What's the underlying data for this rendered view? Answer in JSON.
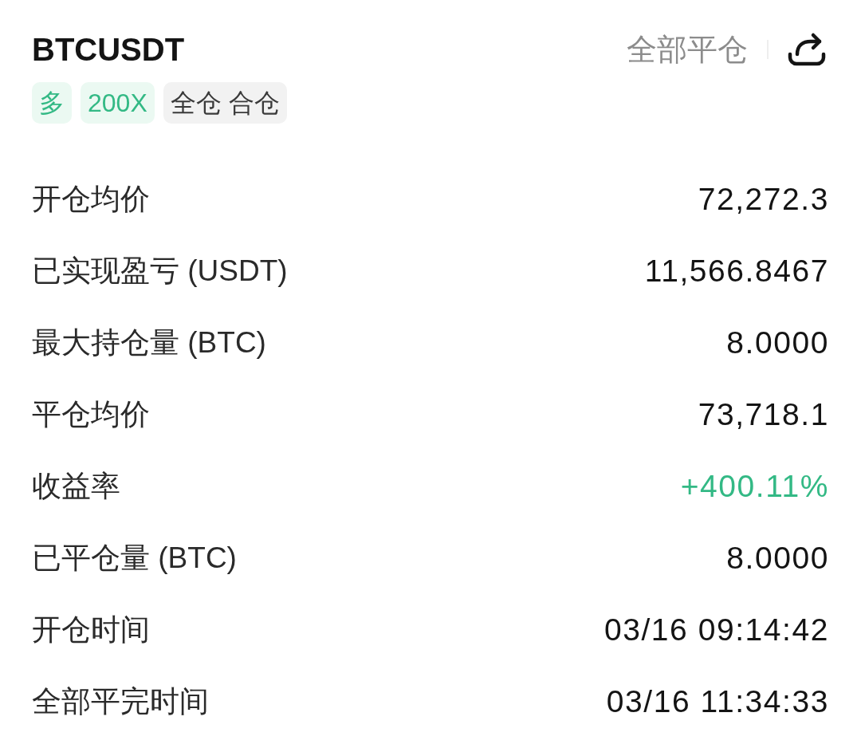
{
  "header": {
    "symbol": "BTCUSDT",
    "close_all": "全部平仓"
  },
  "tags": [
    {
      "label": "多",
      "kind": "accent"
    },
    {
      "label": "200X",
      "kind": "accent"
    },
    {
      "label": "全仓 合仓",
      "kind": "neutral"
    }
  ],
  "rows": [
    {
      "label": "开仓均价",
      "value": "72,272.3",
      "kind": "plain"
    },
    {
      "label": "已实现盈亏 (USDT)",
      "value": "11,566.8467",
      "kind": "plain"
    },
    {
      "label": "最大持仓量 (BTC)",
      "value": "8.0000",
      "kind": "plain"
    },
    {
      "label": "平仓均价",
      "value": "73,718.1",
      "kind": "plain"
    },
    {
      "label": "收益率",
      "value": "+400.11%",
      "kind": "gain"
    },
    {
      "label": "已平仓量 (BTC)",
      "value": "8.0000",
      "kind": "plain"
    },
    {
      "label": "开仓时间",
      "value": "03/16 09:14:42",
      "kind": "plain"
    },
    {
      "label": "全部平完时间",
      "value": "03/16 11:34:33",
      "kind": "plain"
    }
  ]
}
